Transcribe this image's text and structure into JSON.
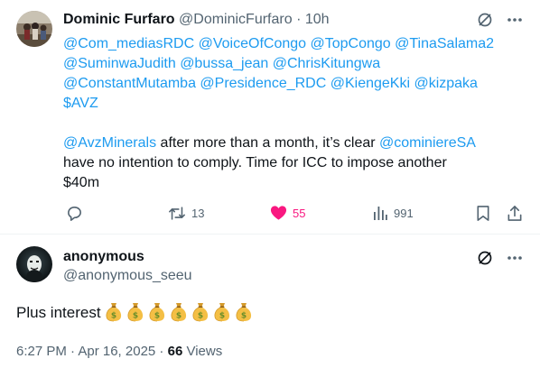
{
  "parent": {
    "author": {
      "display_name": "Dominic Furfaro",
      "handle": "@DominicFurfaro",
      "time": "· 10h"
    },
    "mention_line1": "@Com_mediasRDC @VoiceOfCongo @TopCongo @TinaSalama2",
    "mention_line2": "@SuminwaJudith @bussa_jean @ChrisKitungwa",
    "mention_line3": "@ConstantMutamba @Presidence_RDC @KiengeKki @kizpaka",
    "mention_line4": "$AVZ",
    "body": {
      "mention_a": "@AvzMinerals",
      "text_a": " after more than a month, it’s clear ",
      "mention_b": "@cominiereSA",
      "line2": "have no intention to comply. Time for ICC to impose another",
      "line3": "$40m"
    },
    "actions": {
      "reply_icon": "reply-icon",
      "retweet_count": "13",
      "like_count": "55",
      "views_count": "991"
    }
  },
  "reply": {
    "author": {
      "display_name": "anonymous",
      "handle": "@anonymous_seeu"
    },
    "text": "Plus interest",
    "emoji": "money-bag-icon",
    "emoji_count": 7,
    "meta": {
      "timestamp": "6:27 PM · Apr 16, 2025 ·",
      "views_count": "66",
      "views_label": "Views"
    }
  },
  "colors": {
    "accent": "#1d9bf0",
    "like": "#f91880",
    "muted": "#536471",
    "text": "#0f1419",
    "divider": "#eff3f4"
  }
}
